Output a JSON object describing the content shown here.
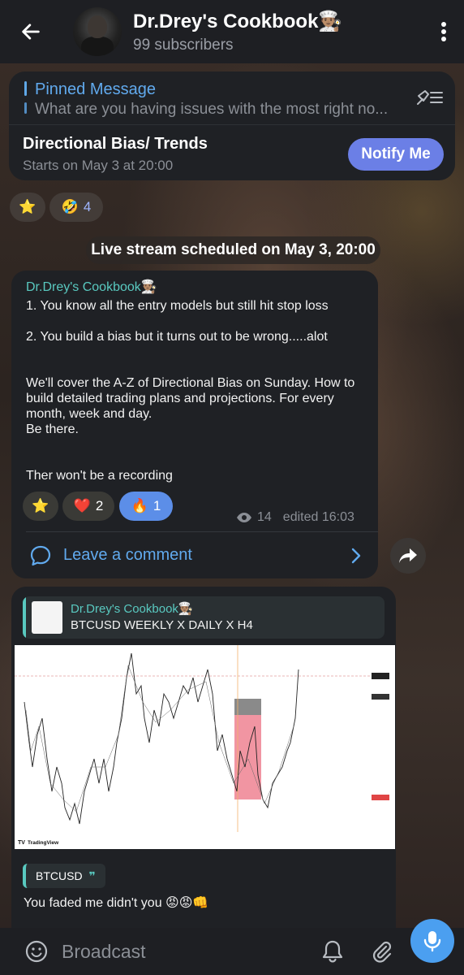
{
  "header": {
    "title": "Dr.Drey's Cookbook👨🏽‍🍳",
    "subtitle": "99 subscribers"
  },
  "pinned": {
    "label": "Pinned Message",
    "text": "What are you having issues with the most right no...",
    "live_title": "Directional Bias/ Trends",
    "live_sub": "Starts on May 3 at 20:00",
    "notify_label": "Notify Me"
  },
  "reactions_top": [
    {
      "emoji": "⭐",
      "count": ""
    },
    {
      "emoji": "🤣",
      "count": "4"
    }
  ],
  "date_pill": "Live stream scheduled on May 3, 20:00",
  "message1": {
    "sender": "Dr.Drey's Cookbook👨🏽‍🍳",
    "line1": "1. You know all the entry models but still hit stop loss",
    "line2": "2. You build a bias but it turns out to be wrong.....alot",
    "para1": "We'll cover the A-Z of Directional Bias on Sunday. How to build detailed trading plans and projections. For every month, week and day.",
    "para2": "Be there.",
    "para3": "Ther won't be a recording",
    "reactions": [
      {
        "emoji": "⭐",
        "count": ""
      },
      {
        "emoji": "❤️",
        "count": "2"
      },
      {
        "emoji": "🔥",
        "count": "1"
      }
    ],
    "views": "14",
    "edited": "edited 16:03",
    "comment_label": "Leave a comment"
  },
  "message2": {
    "quote_name": "Dr.Drey's Cookbook👨🏽‍🍳",
    "quote_text": "BTCUSD WEEKLY X DAILY X H4",
    "chart_brand": "TradingView",
    "reply_chip": "BTCUSD",
    "reply_text": "You faded me didn't you 😡😡👊"
  },
  "input": {
    "placeholder": "Broadcast"
  },
  "colors": {
    "accent": "#61aaee",
    "sender": "#59c9c0",
    "notify": "#6b7fe6",
    "mic": "#4b9ff0",
    "bubble": "#1f2125"
  }
}
